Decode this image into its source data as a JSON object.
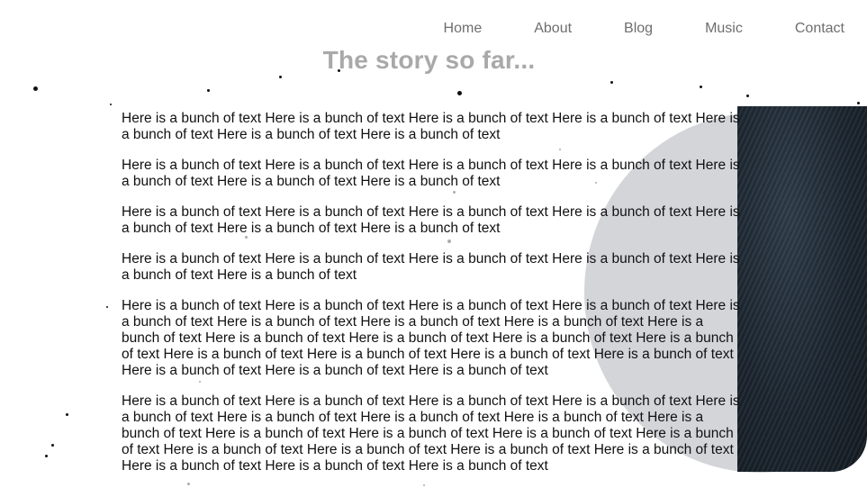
{
  "nav": {
    "items": [
      {
        "label": "Home"
      },
      {
        "label": "About"
      },
      {
        "label": "Blog"
      },
      {
        "label": "Music"
      },
      {
        "label": "Contact"
      }
    ]
  },
  "hero": {
    "title": "The story so far..."
  },
  "content": {
    "paragraphs": [
      "Here is a bunch of text Here is a bunch of text Here is a bunch of text Here is a bunch of text Here is a bunch of text Here is a bunch of text Here is a bunch of text",
      "Here is a bunch of text Here is a bunch of text Here is a bunch of text Here is a bunch of text Here is a bunch of text Here is a bunch of text Here is a bunch of text",
      "Here is a bunch of text Here is a bunch of text Here is a bunch of text Here is a bunch of text Here is a bunch of text Here is a bunch of text Here is a bunch of text",
      "Here is a bunch of text Here is a bunch of text Here is a bunch of text Here is a bunch of text Here is a bunch of text Here is a bunch of text",
      "Here is a bunch of text Here is a bunch of text Here is a bunch of text Here is a bunch of text Here is a bunch of text Here is a bunch of text Here is a bunch of text Here is a bunch of text Here is a bunch of text Here is a bunch of text Here is a bunch of text Here is a bunch of text Here is a bunch of text Here is a bunch of text Here is a bunch of text Here is a bunch of text Here is a bunch of text Here is a bunch of text Here is a bunch of text Here is a bunch of text",
      "Here is a bunch of text Here is a bunch of text Here is a bunch of text Here is a bunch of text Here is a bunch of text Here is a bunch of text Here is a bunch of text Here is a bunch of text Here is a bunch of text Here is a bunch of text Here is a bunch of text Here is a bunch of text Here is a bunch of text Here is a bunch of text Here is a bunch of text Here is a bunch of text Here is a bunch of text Here is a bunch of text Here is a bunch of text Here is a bunch of text"
    ]
  },
  "colors": {
    "nav_text": "#6e6e6e",
    "title_text": "#a9a9a9",
    "body_text": "#111111",
    "circle": "#d3d5d9",
    "panel": "#1c2630"
  }
}
